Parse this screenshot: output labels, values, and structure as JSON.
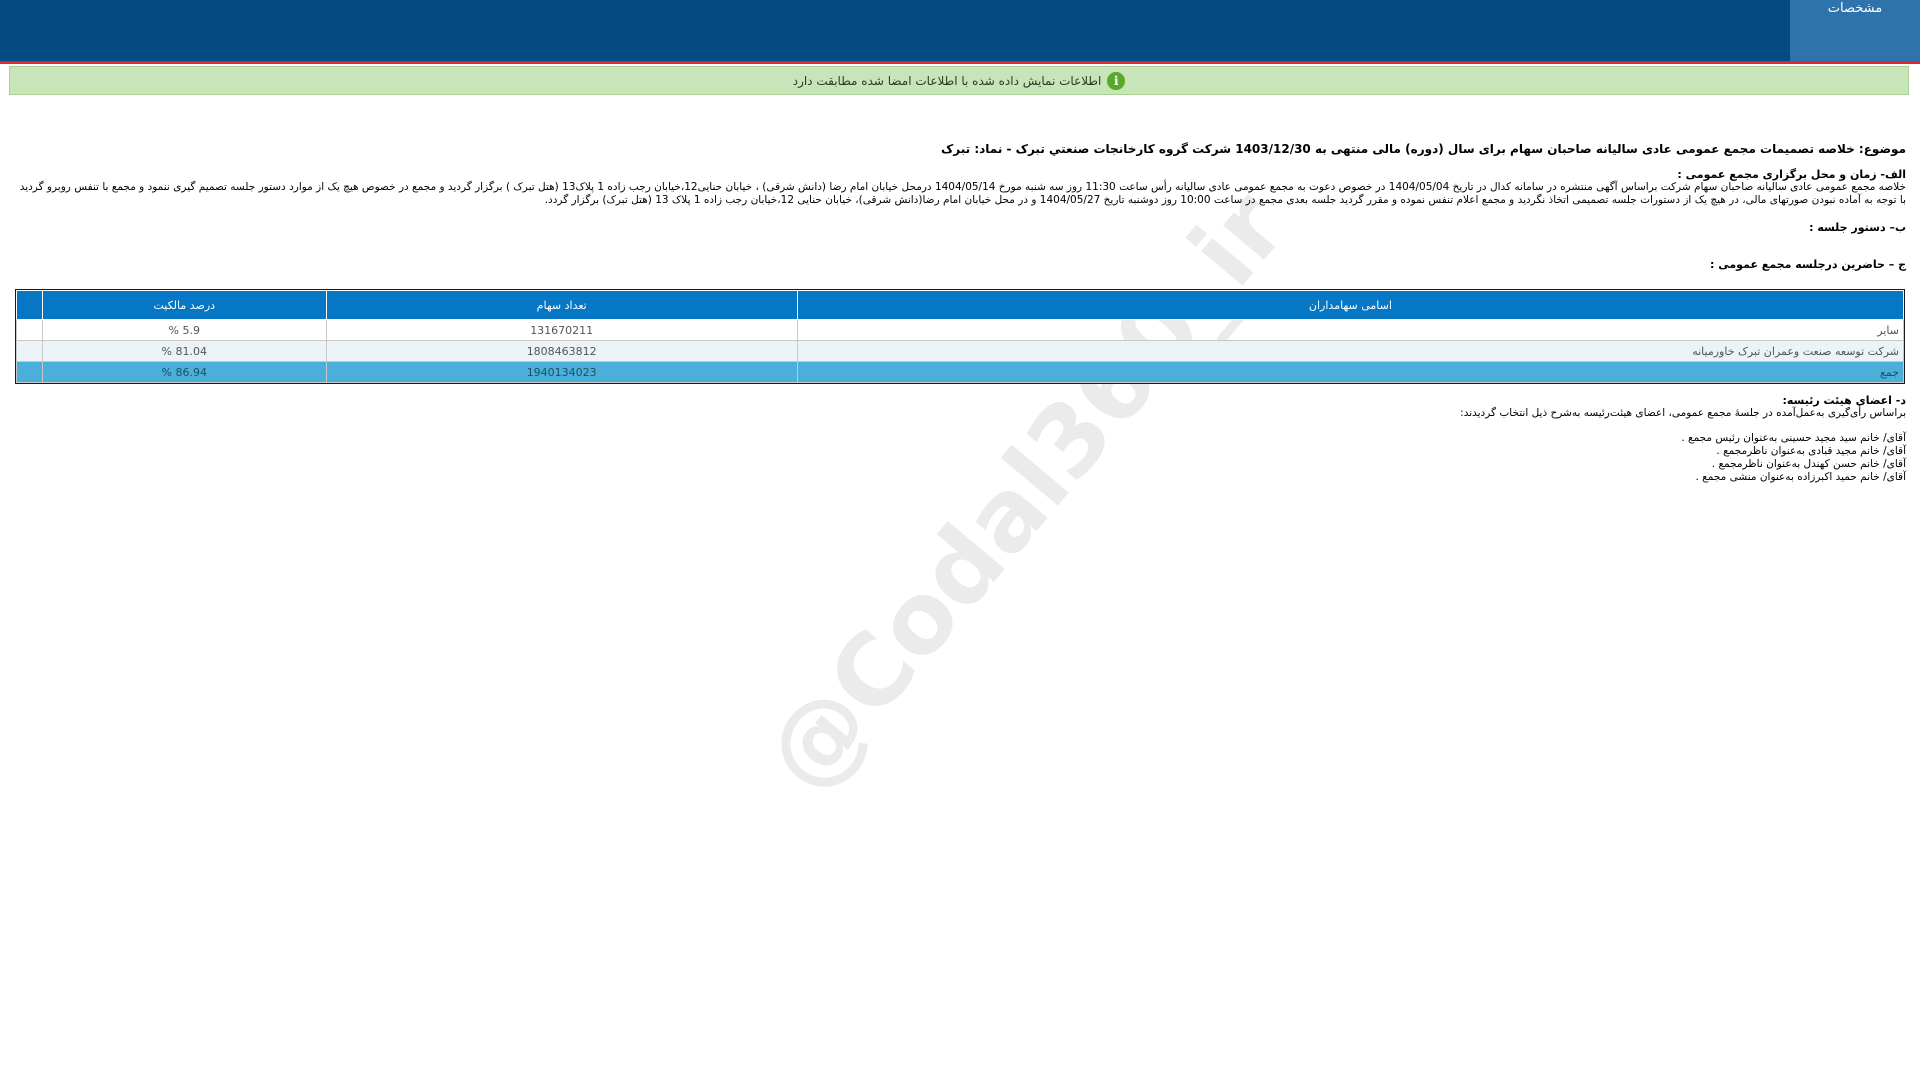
{
  "header": {
    "tab_label": "مشخصات"
  },
  "notice": {
    "icon": "info-icon",
    "text": "اطلاعات نمایش داده شده با اطلاعات امضا شده مطابقت دارد"
  },
  "watermark": "@Codal360_ir",
  "subject": "موضوع: خلاصه تصمیمات مجمع عمومی عادی سالیانه صاحبان سهام برای سال (دوره) مالی منتهی به 1403/12/30 شرکت گروه کارخانجات صنعتي تبرک - نماد: تبرک",
  "section_a": {
    "heading": "الف- زمان و محل برگزاری مجمع عمومی :",
    "para1": "خلاصه مجمع عمومی عادی سالیانه صاحبان سهام شرکت براساس آگهی منتشره در سامانه کدال در تاریخ 1404/05/04 در خصوص دعوت به مجمع عمومی عادی سالیانه رأس ساعت 11:30 روز سه شنبه مورخ 1404/05/14 درمحل  خیابان امام رضا (دانش شرقی) ، خیابان حنایی12،خیابان رجب زاده 1 پلاک13 (هتل تبرک )   برگزار گردید و مجمع در خصوص هیچ یک از موارد دستور جلسه تصمیم گیری ننمود و مجمع با تنفس روبرو گردید",
    "para2": "با توجه به آماده نبودن صورتهای مالی، در هیچ یک از دستورات جلسه تصمیمی اتخاذ نگردید و مجمع اعلام تنفس نموده و مقرر گردید جلسه بعدی مجمع در ساعت 10:00 روز دوشنبه تاریخ 1404/05/27 و در محل خیابان امام رضا(دانش شرقی)، خیابان حنایی 12،خیابان رجب زاده 1 پلاک 13 (هتل تبرک) برگزار گردد."
  },
  "section_b": {
    "heading": "ب– دستور جلسه :"
  },
  "section_c": {
    "heading": "ج – حاضرین درجلسه مجمع عمومی :",
    "columns": [
      "اسامی سهامداران",
      "تعداد سهام",
      "درصد مالکیت"
    ],
    "rows": [
      {
        "name": "سایر",
        "shares": "131670211",
        "percent": "5.9 %"
      },
      {
        "name": "شرکت توسعه صنعت وعمران تبرک خاورمیانه",
        "shares": "1808463812",
        "percent": "81.04 %"
      },
      {
        "name": "جمع",
        "shares": "1940134023",
        "percent": "86.94 %"
      }
    ]
  },
  "section_d": {
    "heading": "د- اعضای هیئت رئیسه:",
    "intro": "براساس رأی‌گیری به‌عمل‌آمده در جلسهٔ مجمع عمومی، اعضای هیئت‌رئیسه به‌شرح ذیل انتخاب گردیدند:",
    "members": [
      "آقای/ خانم  سید مجید حسینی  به‌عنوان رئیس مجمع .",
      "آقای/ خانم  مجید قبادی  به‌عنوان ناظرمجمع .",
      "آقای/ خانم  حسن کهندل  به‌عنوان ناظرمجمع .",
      "آقای/ خانم  حمید اکبرزاده  به‌عنوان منشی مجمع ."
    ]
  }
}
